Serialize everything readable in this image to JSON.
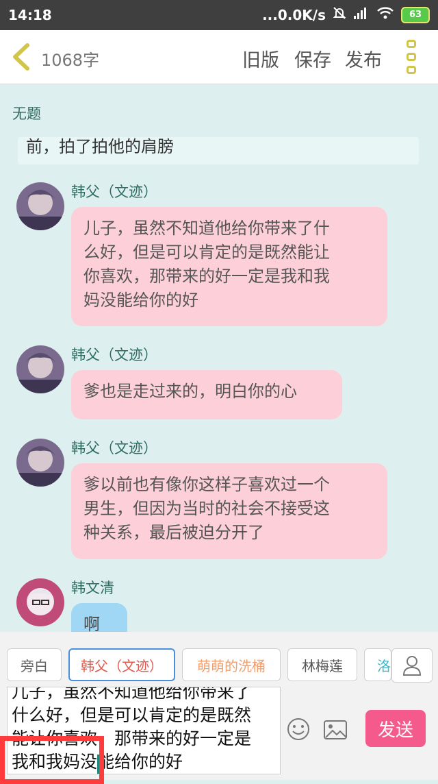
{
  "status_bar": {
    "time": "14:18",
    "network_speed": "...0.0K/s",
    "battery_level": "63"
  },
  "top_bar": {
    "word_count": "1068字",
    "old_version": "旧版",
    "save": "保存",
    "publish": "发布"
  },
  "chapter": {
    "title": "无题"
  },
  "narration": {
    "text": "前，拍了拍他的肩膀"
  },
  "messages": [
    {
      "speaker": "韩父（文迹）",
      "lines": [
        "儿子，虽然不知道他给你带来了什",
        "么好，但是可以肯定的是既然能让",
        "你喜欢，那带来的好一定是我和我",
        "妈没能给你的好"
      ]
    },
    {
      "speaker": "韩父（文迹）",
      "lines": [
        "爹也是走过来的，明白你的心"
      ]
    },
    {
      "speaker": "韩父（文迹）",
      "lines": [
        "爹以前也有像你这样子喜欢过一个",
        "男生，但因为当时的社会不接受这",
        "种关系，最后被迫分开了"
      ]
    },
    {
      "speaker": "韩文清",
      "lines": [
        "啊"
      ]
    }
  ],
  "roles": [
    {
      "label": "旁白",
      "color": "#666666"
    },
    {
      "label": "韩父（文迹）",
      "color": "#e05a4e"
    },
    {
      "label": "萌萌的洗桶",
      "color": "#f0a070"
    },
    {
      "label": "林梅莲",
      "color": "#555555"
    },
    {
      "label": "洛",
      "color": "#3cb8c8"
    }
  ],
  "composer": {
    "lines": [
      "儿子，虽然不知道他给你带来了",
      "什么好，但是可以肯定的是既然",
      "能让你喜欢，那带来的好一定是",
      "我和我妈没能给你的好"
    ],
    "send_label": "发送"
  },
  "icons": {
    "back": "chevron-left-icon",
    "menu": "more-vertical-icon",
    "user": "user-icon",
    "emoji": "emoji-icon",
    "image": "image-icon"
  },
  "colors": {
    "accent": "#f55a8d",
    "bubble_pink": "#fdd0d9",
    "bubble_blue": "#9fd7f4",
    "chat_bg": "#ddf0ef"
  }
}
